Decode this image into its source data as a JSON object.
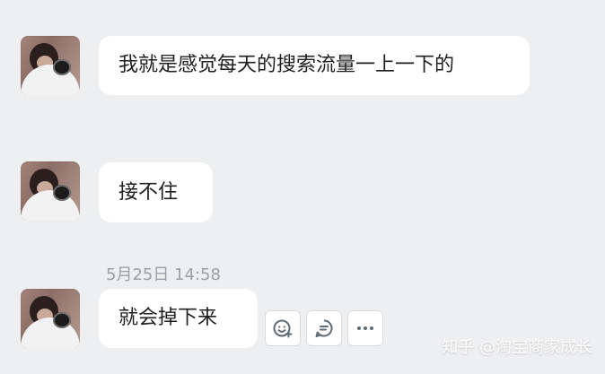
{
  "messages": [
    {
      "text": "我就是感觉每天的搜索流量一上一下的"
    },
    {
      "text": "接不住"
    },
    {
      "timestamp": "5月25日 14:58",
      "text": "就会掉下来"
    }
  ],
  "actions": [
    {
      "icon": "emoji-add-icon"
    },
    {
      "icon": "quote-reply-icon"
    },
    {
      "icon": "more-options-icon"
    }
  ],
  "watermark": "知乎 @淘宝商家成长"
}
